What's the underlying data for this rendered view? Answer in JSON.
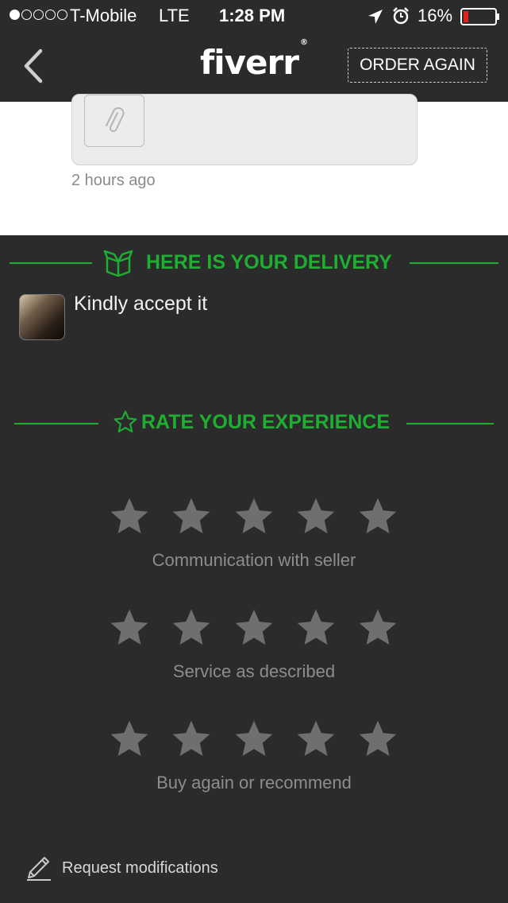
{
  "status_bar": {
    "carrier": "T-Mobile",
    "network": "LTE",
    "time": "1:28 PM",
    "battery": "16%",
    "signal_bars": 1,
    "battery_level": 0.16
  },
  "header": {
    "logo": "fiverr",
    "logo_mark": "®",
    "order_again_label": "ORDER AGAIN"
  },
  "message": {
    "timestamp": "2 hours ago"
  },
  "delivery": {
    "title": "HERE IS YOUR DELIVERY",
    "text": "Kindly accept it"
  },
  "rating": {
    "title": "RATE YOUR EXPERIENCE",
    "categories": [
      {
        "label": "Communication with seller",
        "stars": 0
      },
      {
        "label": "Service as described",
        "stars": 0
      },
      {
        "label": "Buy again or recommend",
        "stars": 0
      }
    ]
  },
  "actions": {
    "request_modifications": "Request modifications"
  },
  "colors": {
    "accent": "#1dae32",
    "background": "#2b2b2b",
    "star_inactive": "#6f6f6f",
    "battery_low": "#e02020"
  }
}
